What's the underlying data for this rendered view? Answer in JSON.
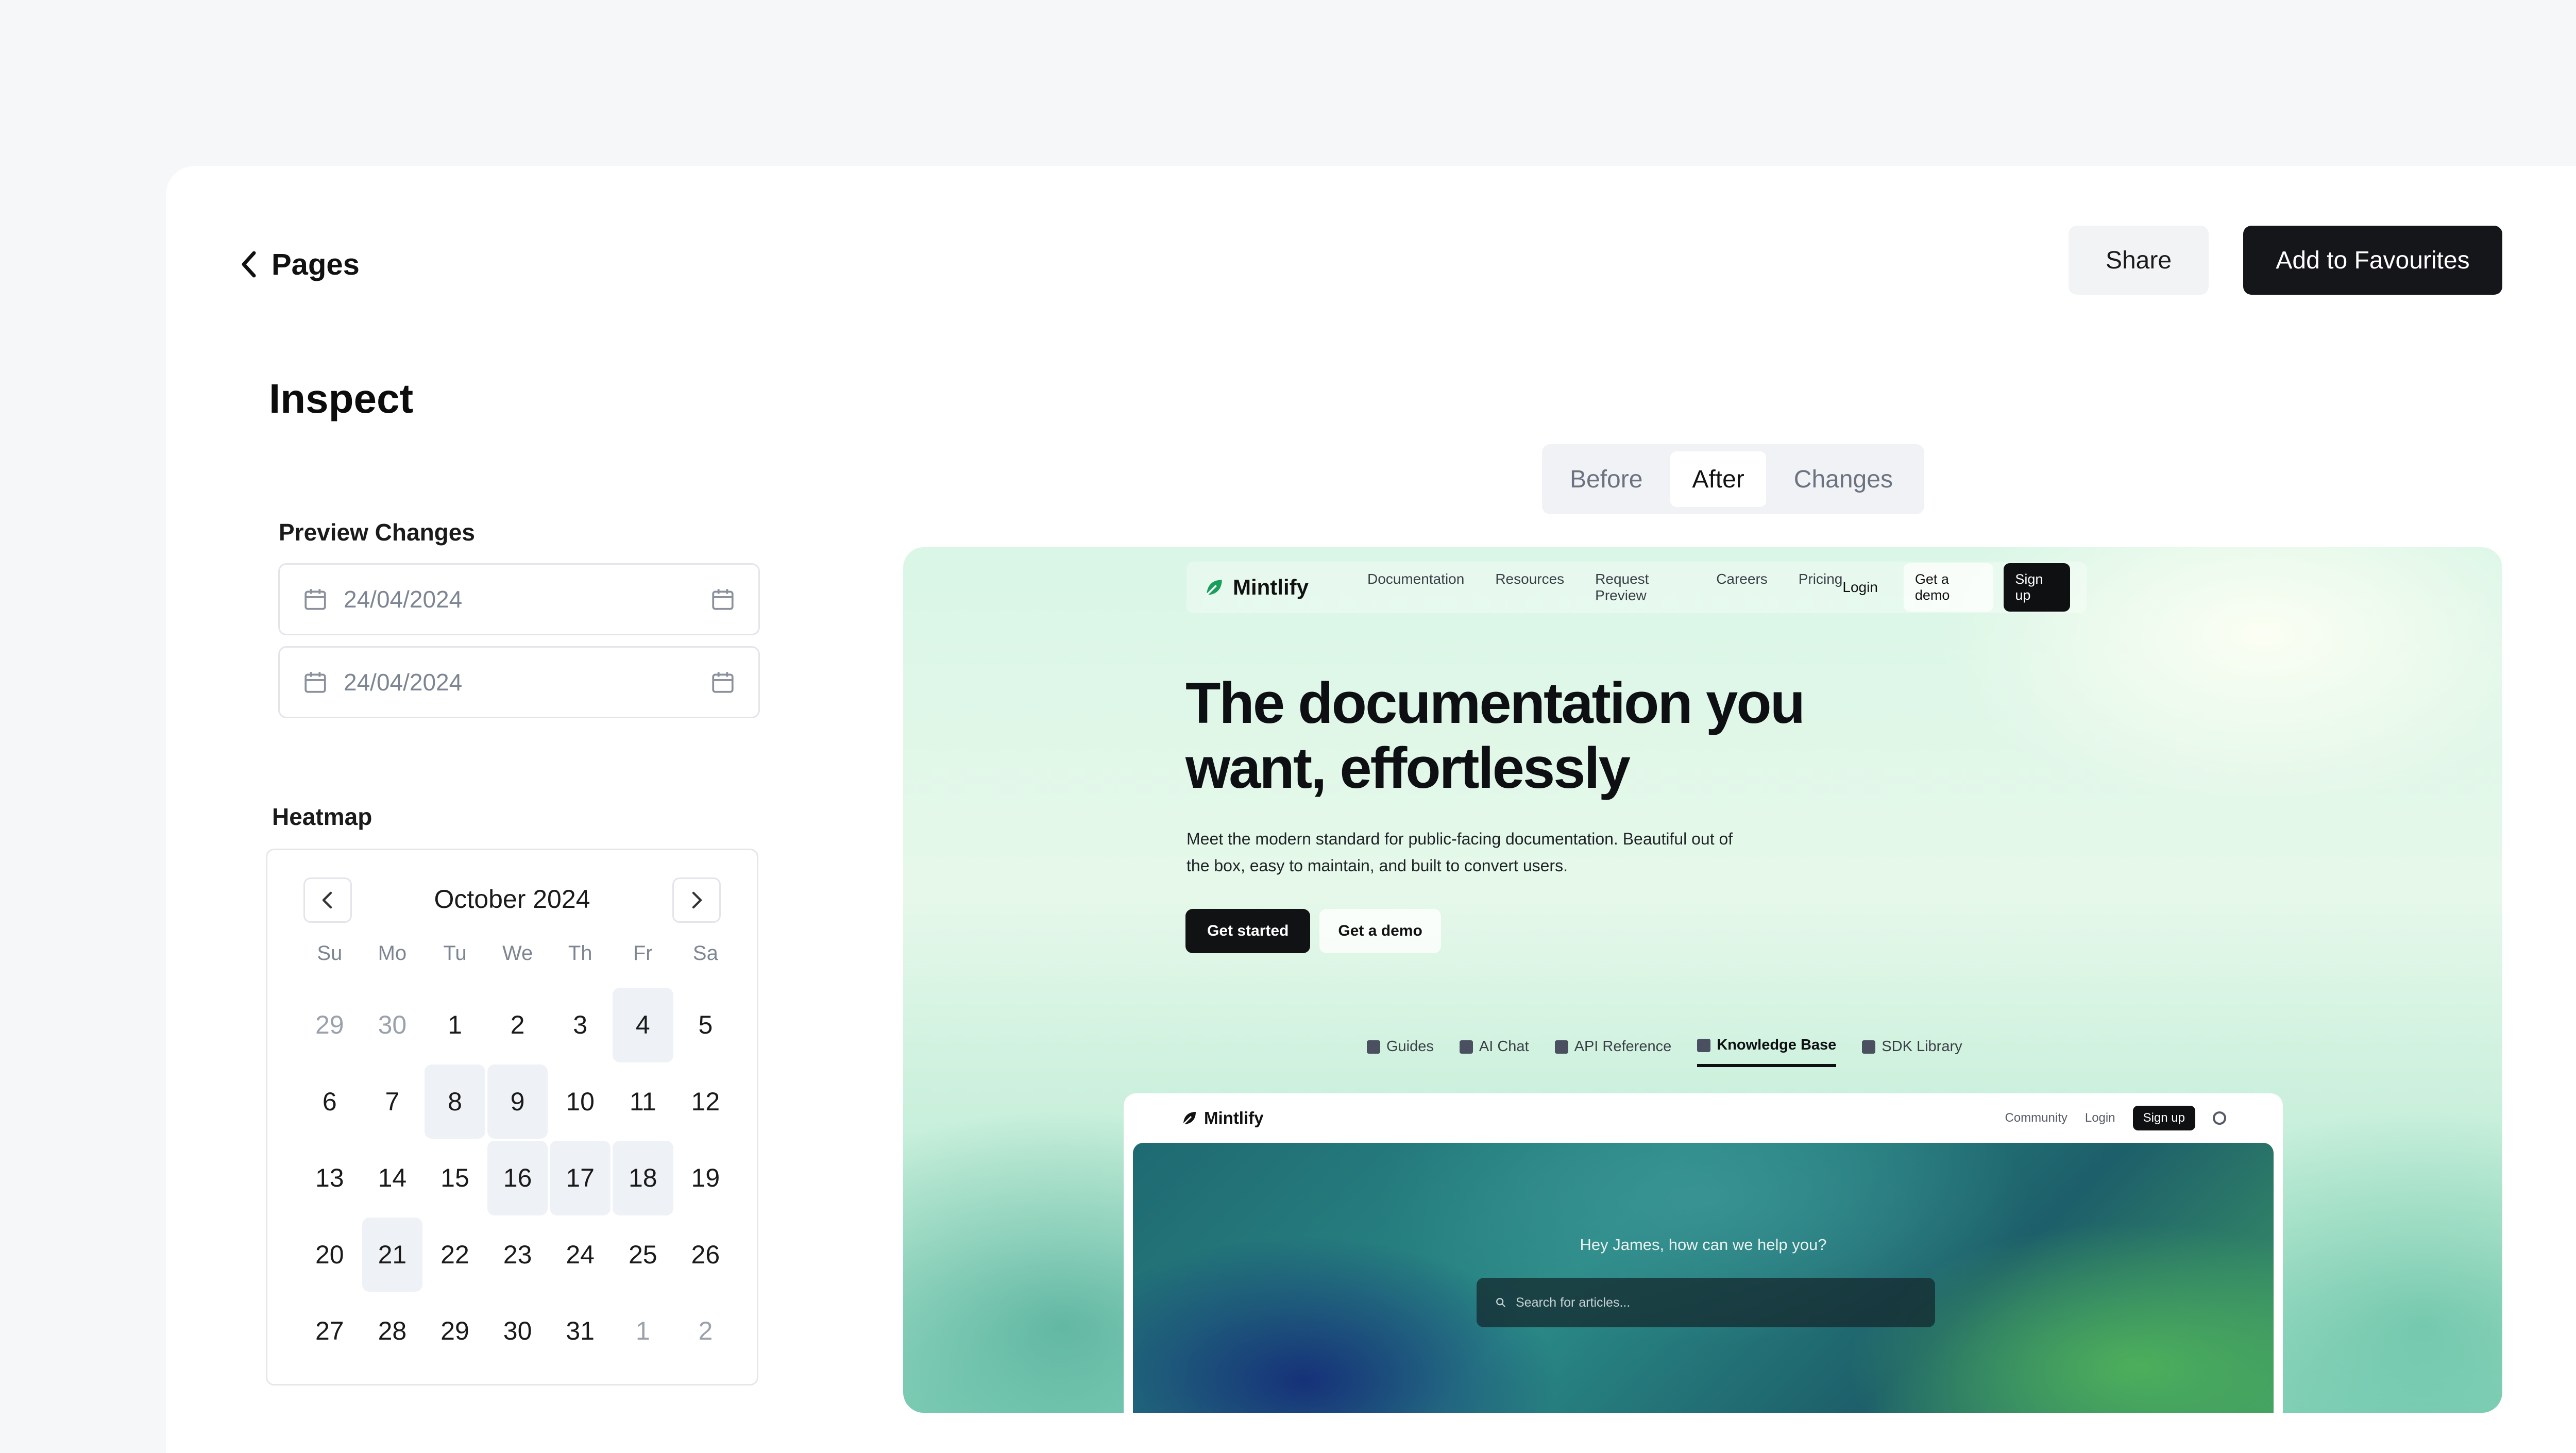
{
  "header": {
    "back_label": "Pages",
    "share_label": "Share",
    "favourite_label": "Add to Favourites"
  },
  "sidebar": {
    "title": "Inspect",
    "preview_label": "Preview Changes",
    "date_start": "24/04/2024",
    "date_end": "24/04/2024",
    "heatmap_label": "Heatmap"
  },
  "calendar": {
    "month": "October 2024",
    "weekdays": [
      "Su",
      "Mo",
      "Tu",
      "We",
      "Th",
      "Fr",
      "Sa"
    ],
    "days": [
      {
        "d": "29",
        "muted": true
      },
      {
        "d": "30",
        "muted": true
      },
      {
        "d": "1"
      },
      {
        "d": "2"
      },
      {
        "d": "3"
      },
      {
        "d": "4",
        "hl": true
      },
      {
        "d": "5"
      },
      {
        "d": "6"
      },
      {
        "d": "7"
      },
      {
        "d": "8",
        "hl": true
      },
      {
        "d": "9",
        "hl": true
      },
      {
        "d": "10"
      },
      {
        "d": "11"
      },
      {
        "d": "12"
      },
      {
        "d": "13"
      },
      {
        "d": "14"
      },
      {
        "d": "15"
      },
      {
        "d": "16",
        "hl": true
      },
      {
        "d": "17",
        "hl": true
      },
      {
        "d": "18",
        "hl": true
      },
      {
        "d": "19"
      },
      {
        "d": "20"
      },
      {
        "d": "21",
        "hl": true
      },
      {
        "d": "22"
      },
      {
        "d": "23"
      },
      {
        "d": "24"
      },
      {
        "d": "25"
      },
      {
        "d": "26"
      },
      {
        "d": "27"
      },
      {
        "d": "28"
      },
      {
        "d": "29"
      },
      {
        "d": "30"
      },
      {
        "d": "31"
      },
      {
        "d": "1",
        "muted": true
      },
      {
        "d": "2",
        "muted": true
      }
    ]
  },
  "view_toggle": {
    "options": [
      "Before",
      "After",
      "Changes"
    ],
    "selected": "After"
  },
  "preview": {
    "nav": {
      "brand": "Mintlify",
      "links": [
        "Documentation",
        "Resources",
        "Request Preview",
        "Careers",
        "Pricing"
      ],
      "login": "Login",
      "demo": "Get a demo",
      "signup": "Sign up"
    },
    "hero": {
      "title_line1": "The documentation you",
      "title_line2": "want, effortlessly",
      "subtitle_line1": "Meet the modern standard for public-facing documentation. Beautiful out of",
      "subtitle_line2": "the box, easy to maintain, and built to convert users.",
      "primary_cta": "Get started",
      "secondary_cta": "Get a demo"
    },
    "tabs": [
      "Guides",
      "AI Chat",
      "API Reference",
      "Knowledge Base",
      "SDK Library"
    ],
    "active_tab": "Knowledge Base",
    "inner": {
      "brand": "Mintlify",
      "community": "Community",
      "login": "Login",
      "signup": "Sign up",
      "greeting": "Hey James, how can we help you?",
      "search_placeholder": "Search for articles..."
    }
  },
  "colors": {
    "primary_button": "#15161a",
    "highlight_day": "#eef1f5"
  }
}
